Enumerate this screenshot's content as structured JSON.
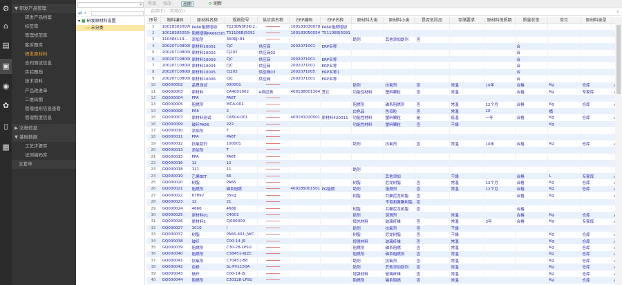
{
  "iconbar": [
    "settings-icon",
    "home-icon",
    "document-icon",
    "printer-icon",
    "globe-icon",
    "gear-icon",
    "book-icon",
    "keyboard-icon"
  ],
  "menu": {
    "group1": "▼ 研发产品管理",
    "items": [
      "研发产品档案",
      "标签库",
      "管理规范库",
      "客诉图库",
      "研发原材料",
      "合同测试信息",
      "实验图档",
      "技术资料",
      "产品改进单",
      "二维码图",
      "管理组织信息查看",
      "管理制度信息"
    ],
    "active": "研发原材料",
    "group2": "▶ 文档信息",
    "group3": "▼ 基础数据",
    "items2": [
      "工艺步骤库",
      "证测编码库"
    ],
    "group4": "文套单"
  },
  "tree": {
    "search_placeholder": "▾",
    "root": "研发原材料设置",
    "child": "未分类"
  },
  "toolbar": {
    "add": "新增",
    "edit": "修改",
    "export": "出图",
    "refresh": "刷新",
    "enable": "启用(E)",
    "disable": "禁用(D)"
  },
  "table": {
    "columns": [
      "序号",
      "物料编码",
      "原材料名称",
      "规格型号",
      "供应商名称",
      "ERP编码",
      "ERP名称",
      "原材料大类",
      "原材料小类",
      "是否危险品",
      "存储要求",
      "原材料保质期",
      "质量状态",
      "单位",
      "原材料类型",
      "创建人"
    ],
    "rows": [
      [
        "1",
        "100183030078",
        "PA66阻燃增韧",
        "T2230NSF3K(2...",
        "",
        "100183030078",
        "PA66阻燃增韧",
        "",
        "",
        "",
        "",
        "",
        "",
        "",
        "",
        ""
      ],
      [
        "2",
        "100183050554",
        "阻燃增强PA66(5091",
        "T51106B(5091",
        "",
        "100183050554",
        "T51106B(5091",
        "",
        "",
        "",
        "",
        "",
        "",
        "",
        "",
        ""
      ],
      [
        "3",
        "110484113...",
        "添加剂",
        "3606JI-81",
        "",
        "",
        "",
        "助剂",
        "其他添加助剂",
        "否",
        "",
        "",
        "",
        "",
        "",
        ""
      ],
      [
        "4",
        "2002071080001",
        "原材料10001",
        "CJC",
        "供应商",
        "2002071001",
        "ERP名称",
        "",
        "",
        "",
        "",
        "",
        "合",
        "",
        "",
        ""
      ],
      [
        "5",
        "2002071080002",
        "原材料10002",
        "CJ202",
        "供应商02",
        "",
        "",
        "",
        "",
        "",
        "",
        "",
        "合",
        "",
        "",
        ""
      ],
      [
        "6",
        "2002071080003",
        "原材料10003",
        "CJC",
        "供应商",
        "2002071001",
        "ERP名称",
        "",
        "",
        "",
        "",
        "",
        "合",
        "",
        "",
        ""
      ],
      [
        "7",
        "2002071080004",
        "原材料10004",
        "CJC",
        "供应商",
        "2002071001",
        "ERP名称",
        "",
        "",
        "",
        "",
        "",
        "合",
        "",
        "",
        ""
      ],
      [
        "8",
        "2002071080005",
        "原材料10005",
        "CJ203",
        "供应商03",
        "2002071005",
        "ERP名称1",
        "",
        "",
        "",
        "",
        "",
        "合",
        "",
        "",
        ""
      ],
      [
        "9",
        "2002071080006",
        "原材料10006",
        "CJC",
        "供应商",
        "2002071001",
        "ERP名称",
        "",
        "",
        "",
        "",
        "",
        "合",
        "",
        "",
        ""
      ],
      [
        "10",
        "GQ000002",
        "品质测试",
        "000001",
        "",
        "",
        "",
        "助剂",
        "抗氧剂",
        "否",
        "常温",
        "10年",
        "合格",
        "Kg",
        "仓库",
        "人"
      ],
      [
        "11",
        "GQ000003",
        "原材料",
        "CA4001002",
        "A供应商",
        "400188001304",
        "其它",
        "功能性材料",
        "塑料颗粒",
        "否",
        "常温",
        "",
        "合格",
        "Kg",
        "专家库",
        "人"
      ],
      [
        "12",
        "GQ000004",
        "PPA",
        "PA6T",
        "",
        "",
        "",
        "",
        "",
        "",
        "",
        "",
        "",
        "",
        "",
        ""
      ],
      [
        "13",
        "GQ000005",
        "阻燃剂",
        "MCA-001",
        "",
        "",
        "",
        "阻燃剂",
        "磷系阻燃剂",
        "否",
        "常温",
        "12个月",
        "合格",
        "Kg",
        "仓库",
        "人"
      ],
      [
        "14",
        "GQ000006",
        "PA6",
        "2",
        "",
        "",
        "",
        "白色品",
        "色母粒",
        "否",
        "常温",
        "10",
        "",
        "桶",
        "",
        ""
      ],
      [
        "15",
        "GQ000007",
        "原材料测试",
        "CA504-001",
        "",
        "400181020001",
        "原材料420011",
        "功能性材料",
        "塑料颗粒",
        "是",
        "低温",
        "一年",
        "合格",
        "Kg",
        "仓库",
        "人"
      ],
      [
        "16",
        "GQ000009",
        "玻纤PA66",
        "222",
        "",
        "",
        "",
        "功能性材料",
        "塑料颗粒",
        "否",
        "干燥",
        "",
        "",
        "Kg",
        "",
        ""
      ],
      [
        "17",
        "GQ000010",
        "添加剂",
        "T",
        "",
        "",
        "",
        "",
        "",
        "",
        "",
        "",
        "",
        "",
        "",
        ""
      ],
      [
        "18",
        "GQ000011",
        "PPA",
        "PA6T",
        "",
        "",
        "",
        "",
        "",
        "",
        "",
        "",
        "",
        "",
        "",
        ""
      ],
      [
        "19",
        "GQ000012",
        "抗氧助剂",
        "100001",
        "",
        "",
        "",
        "助剂",
        "抗氧剂",
        "否",
        "常温",
        "10年",
        "合格",
        "Kg",
        "仓库",
        "人"
      ],
      [
        "20",
        "GQ000013",
        "添加剂",
        "T",
        "",
        "",
        "",
        "",
        "",
        "",
        "",
        "",
        "",
        "",
        "",
        ""
      ],
      [
        "21",
        "GQ000015",
        "PPA",
        "PA6T",
        "",
        "",
        "",
        "",
        "",
        "",
        "",
        "",
        "",
        "",
        "",
        ""
      ],
      [
        "22",
        "GQ000016",
        "12",
        "12",
        "",
        "",
        "",
        "",
        "",
        "",
        "",
        "",
        "",
        "",
        "",
        ""
      ],
      [
        "23",
        "GQ000018",
        "111",
        "11",
        "",
        "",
        "",
        "助剂",
        "",
        "",
        "",
        "",
        "",
        "",
        "",
        ""
      ],
      [
        "24",
        "GQ000019",
        "乙烯BET",
        "66",
        "",
        "",
        "",
        "",
        "其他添加",
        "",
        "干燥",
        "",
        "合格",
        "L",
        "专家库",
        "人"
      ],
      [
        "25",
        "GQ000020",
        "树脂",
        "PA66",
        "",
        "",
        "",
        "树脂",
        "尼龙树脂",
        "否",
        "常温",
        "12个月",
        "合格",
        "Kg",
        "仓库",
        "人"
      ],
      [
        "26",
        "GQ000021",
        "阻燃剂",
        "磷系阻燃",
        "",
        "400185001501",
        "PG阻燃",
        "助剂",
        "阻燃剂",
        "否",
        "常温",
        "12个月",
        "合格",
        "Kg",
        "仓库",
        "人"
      ],
      [
        "27",
        "GQ000022",
        "67892",
        "35kg",
        "",
        "",
        "",
        "树脂",
        "共聚尼龙树脂",
        "否",
        "",
        "",
        "合格",
        "Kg",
        "",
        "人"
      ],
      [
        "28",
        "GQ000023",
        "12",
        "21",
        "",
        "",
        "",
        "",
        "不饱和聚酯树脂...",
        "否",
        "",
        "",
        "",
        "",
        "",
        ""
      ],
      [
        "29",
        "GQ000024",
        "4666",
        "4666",
        "",
        "",
        "",
        "树脂",
        "共聚尼龙树脂",
        "否",
        "",
        "",
        "合格",
        "",
        "",
        ""
      ],
      [
        "30",
        "GQ000025",
        "原材料01",
        "C4001",
        "",
        "",
        "",
        "助剂",
        "润滑剂",
        "",
        "常温",
        "",
        "合格",
        "Kg",
        "仓库",
        "人"
      ],
      [
        "31",
        "GQ000026",
        "原材料1",
        "CJ000009",
        "",
        "",
        "",
        "填充材料",
        "玻璃纤维",
        "否",
        "常温",
        "3年",
        "合格",
        "Kg",
        "专家库",
        "人"
      ],
      [
        "32",
        "GQ000027",
        "1010",
        "I",
        "",
        "",
        "",
        "助剂",
        "抗氧剂",
        "否",
        "干燥",
        "",
        "",
        "",
        "",
        ""
      ],
      [
        "33",
        "GQ000037",
        "树脂",
        "PA66-601-JWC",
        "",
        "",
        "",
        "树脂",
        "尼龙树脂",
        "否",
        "干燥",
        "",
        "",
        "Kg",
        "仓库",
        "人"
      ],
      [
        "34",
        "GQ000038",
        "玻纤",
        "C00-14-JS",
        "",
        "",
        "",
        "增强材料",
        "玻璃纤维",
        "否",
        "常温",
        "",
        "",
        "Kg",
        "仓库",
        "人"
      ],
      [
        "35",
        "GQ000039",
        "阻燃剂",
        "C30-28-LPSU",
        "",
        "",
        "",
        "阻燃剂",
        "磷系阻燃",
        "否",
        "常温",
        "",
        "",
        "Kg",
        "仓库",
        "人"
      ],
      [
        "36",
        "GQ000040",
        "阻燃剂",
        "C38451-KJZC",
        "",
        "",
        "",
        "阻燃剂",
        "磷系阻燃剂",
        "否",
        "常温",
        "",
        "",
        "Kg",
        "仓库",
        "人"
      ],
      [
        "37",
        "GQ000041",
        "抗氧剂",
        "C70451-B8",
        "",
        "",
        "",
        "助剂",
        "抗氧剂",
        "否",
        "常温",
        "",
        "",
        "Kg",
        "仓库",
        "人"
      ],
      [
        "38",
        "GQ000042",
        "色粉",
        "SL-PV1150A",
        "",
        "",
        "",
        "助剂",
        "其他添加助剂",
        "否",
        "常温",
        "",
        "",
        "Kg",
        "仓库",
        "人"
      ],
      [
        "39",
        "GQ000043",
        "玻纤",
        "C00-14-JS",
        "",
        "",
        "",
        "增强材料",
        "玻璃纤维",
        "否",
        "常温",
        "",
        "",
        "Kg",
        "仓库",
        "人"
      ],
      [
        "40",
        "GQ000044",
        "阻燃剂",
        "C30128-LPSU",
        "",
        "",
        "",
        "阻燃剂",
        "磷系阻燃",
        "否",
        "常温",
        "",
        "",
        "Kg",
        "仓库",
        "人"
      ]
    ]
  }
}
